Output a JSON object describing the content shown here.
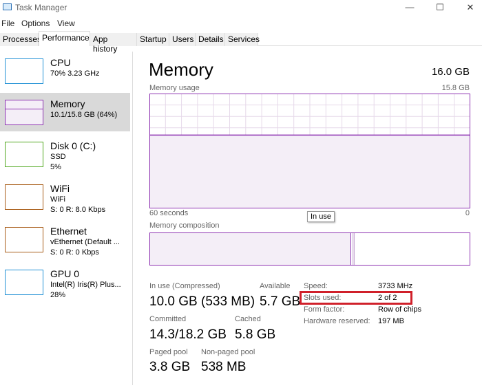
{
  "window": {
    "title": "Task Manager",
    "minimize": "—",
    "maximize": "☐",
    "close": "✕"
  },
  "menu": [
    "File",
    "Options",
    "View"
  ],
  "tabs": [
    "Processes",
    "Performance",
    "App history",
    "Startup",
    "Users",
    "Details",
    "Services"
  ],
  "active_tab": "Performance",
  "sidebar": [
    {
      "name": "CPU",
      "lines": [
        "70% 3.23 GHz"
      ],
      "color": "#1e8fd5"
    },
    {
      "name": "Memory",
      "lines": [
        "10.1/15.8 GB (64%)"
      ],
      "color": "#8b2fb0"
    },
    {
      "name": "Disk 0 (C:)",
      "lines": [
        "SSD",
        "5%"
      ],
      "color": "#4da61a"
    },
    {
      "name": "WiFi",
      "lines": [
        "WiFi",
        "S: 0 R: 8.0 Kbps"
      ],
      "color": "#a75a14"
    },
    {
      "name": "Ethernet",
      "lines": [
        "vEthernet (Default ...",
        "S: 0 R: 0 Kbps"
      ],
      "color": "#a75a14"
    },
    {
      "name": "GPU 0",
      "lines": [
        "Intel(R) Iris(R) Plus...",
        "28%"
      ],
      "color": "#1e8fd5"
    }
  ],
  "main": {
    "title": "Memory",
    "total": "16.0 GB",
    "usage_label": "Memory usage",
    "usage_max": "15.8 GB",
    "usage_percent": 64,
    "time_label": "60 seconds",
    "zero": "0",
    "composition_label": "Memory composition",
    "tooltip": "In use",
    "stats": {
      "in_use_label": "In use (Compressed)",
      "in_use": "10.0 GB (533 MB)",
      "available_label": "Available",
      "available": "5.7 GB",
      "committed_label": "Committed",
      "committed": "14.3/18.2 GB",
      "cached_label": "Cached",
      "cached": "5.8 GB",
      "paged_label": "Paged pool",
      "paged": "3.8 GB",
      "nonpaged_label": "Non-paged pool",
      "nonpaged": "538 MB"
    },
    "specs": [
      {
        "label": "Speed:",
        "value": "3733 MHz"
      },
      {
        "label": "Slots used:",
        "value": "2 of 2"
      },
      {
        "label": "Form factor:",
        "value": "Row of chips"
      },
      {
        "label": "Hardware reserved:",
        "value": "197 MB"
      }
    ],
    "accent": "#8b2fb0",
    "highlight": "#d0202a"
  }
}
